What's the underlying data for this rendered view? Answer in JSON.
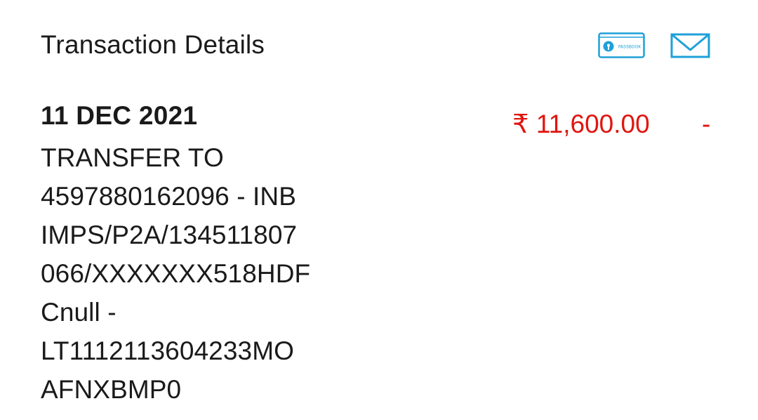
{
  "header": {
    "title": "Transaction Details",
    "passbook_icon_label": "PASSBOOK",
    "icons": [
      "passbook-icon",
      "mail-icon"
    ],
    "accent_color": "#1ea0d8"
  },
  "transaction": {
    "date": "11 DEC 2021",
    "description_lines": [
      "TRANSFER TO",
      "4597880162096 - INB",
      "IMPS/P2A/134511807",
      "066/XXXXXXX518HDF",
      "Cnull -",
      "LT1112113604233MO",
      "AFNXBMP0"
    ],
    "amount": "₹ 11,600.00",
    "amount_color": "#e0150f",
    "balance_marker": "-"
  }
}
